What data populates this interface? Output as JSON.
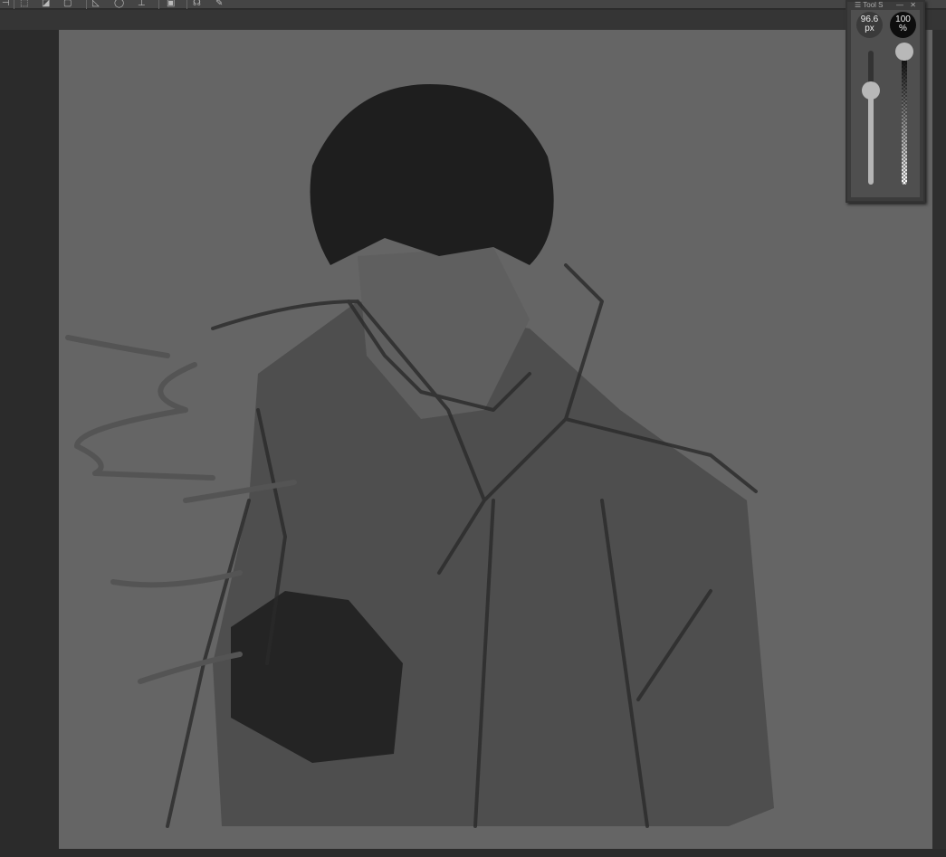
{
  "toolbar": {
    "icons": [
      "selection-icon",
      "fill-icon",
      "frame-icon",
      "ruler-icon",
      "circle-icon",
      "crop-icon",
      "layer-icon",
      "balloon-icon",
      "pen-icon"
    ]
  },
  "tool_panel": {
    "title": "Tool S",
    "brush_size": {
      "value": "96.6",
      "unit": "px",
      "fraction": 0.7
    },
    "opacity": {
      "value": "100",
      "unit": "%",
      "fraction": 1.0
    }
  },
  "canvas": {
    "background": "#656565"
  }
}
